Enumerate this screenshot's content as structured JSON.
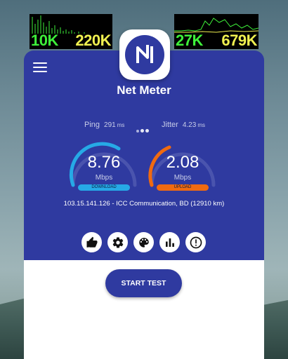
{
  "widgets": {
    "left": {
      "download": "10K",
      "upload": "220K"
    },
    "right": {
      "download": "27K",
      "upload": "679K"
    },
    "download_color": "#3ef03a",
    "upload_color": "#f0f050"
  },
  "app": {
    "title": "Net Meter",
    "icon": "net-meter-logo-icon",
    "brand_color": "#2f3aa0"
  },
  "header": {
    "menu_icon": "hamburger-menu-icon"
  },
  "stats": {
    "ping": {
      "label": "Ping",
      "value": "291",
      "unit": "ms"
    },
    "jitter": {
      "label": "Jitter",
      "value": "4.23",
      "unit": "ms"
    },
    "page_dots": 3
  },
  "gauges": {
    "download": {
      "value": "8.76",
      "unit": "Mbps",
      "label": "DOWNLOAD",
      "color": "#26a9e6"
    },
    "upload": {
      "value": "2.08",
      "unit": "Mbps",
      "label": "UPLOAD",
      "color": "#f06a10"
    }
  },
  "server": {
    "text": "103.15.141.126 - ICC Communication, BD (12910 km)"
  },
  "actions": [
    {
      "name": "rate-button",
      "icon": "thumbs-up-icon"
    },
    {
      "name": "settings-button",
      "icon": "gear-icon"
    },
    {
      "name": "theme-button",
      "icon": "palette-icon"
    },
    {
      "name": "history-button",
      "icon": "bar-chart-icon"
    },
    {
      "name": "info-button",
      "icon": "alert-icon"
    }
  ],
  "start_button": {
    "label": "START TEST"
  }
}
